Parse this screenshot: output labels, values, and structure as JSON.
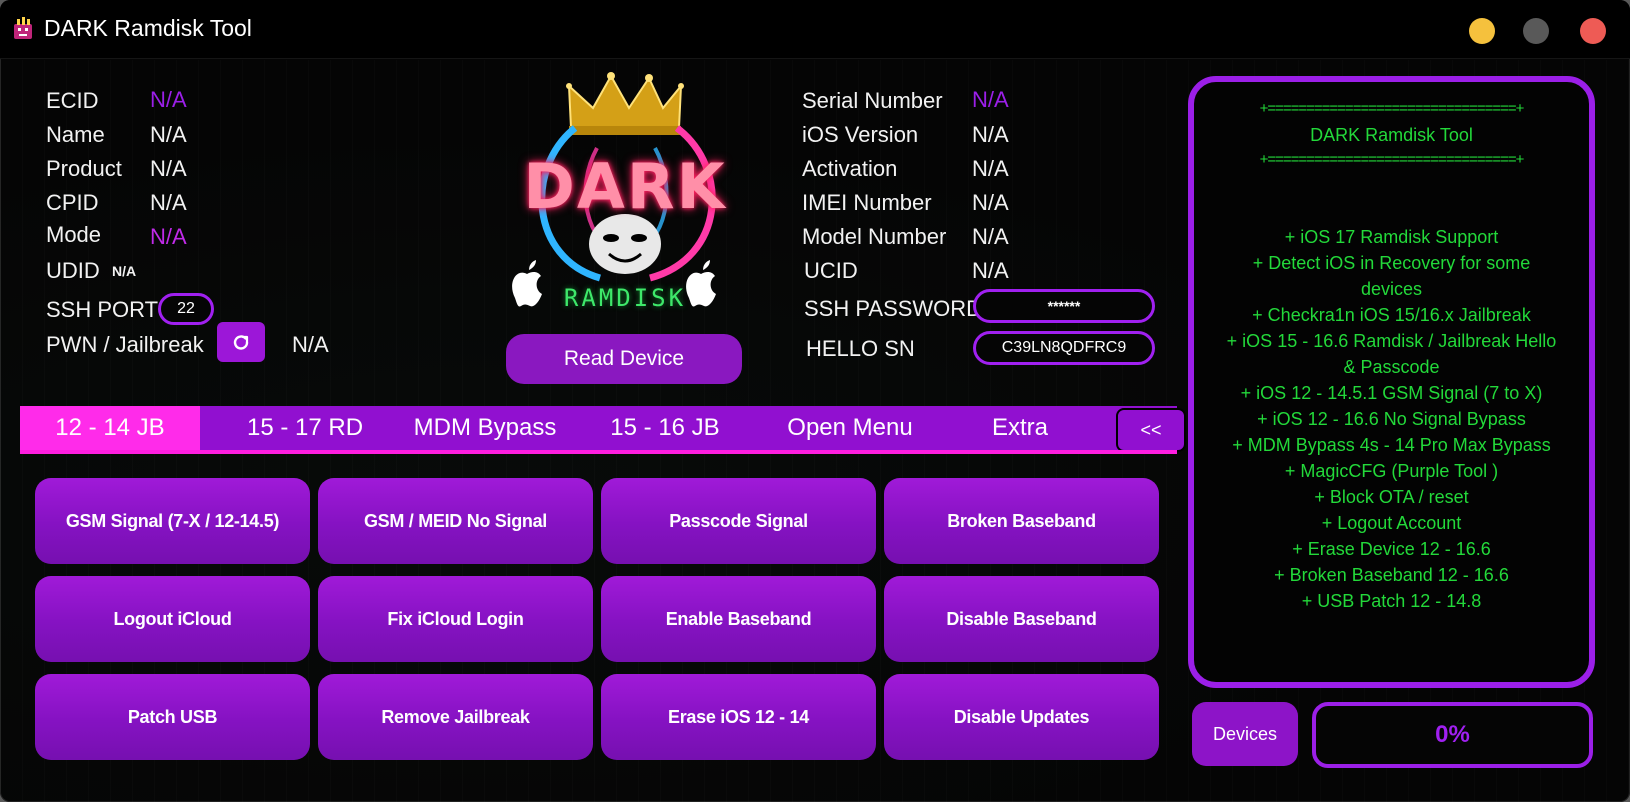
{
  "window": {
    "title": "DARK Ramdisk Tool",
    "controls": {
      "minimize_color": "#f5c13d",
      "maximize_color": "#595959",
      "close_color": "#ee5b55"
    }
  },
  "info_left": {
    "ecid": {
      "label": "ECID",
      "value": "N/A"
    },
    "name": {
      "label": "Name",
      "value": "N/A"
    },
    "product": {
      "label": "Product",
      "value": "N/A"
    },
    "cpid": {
      "label": "CPID",
      "value": "N/A"
    },
    "mode": {
      "label": "Mode",
      "value": "N/A"
    },
    "udid": {
      "label": "UDID",
      "value": "N/A"
    },
    "ssh_port": {
      "label": "SSH PORT",
      "value": "22"
    },
    "pwn": {
      "label": "PWN / Jailbreak",
      "value": "N/A"
    }
  },
  "logo": {
    "title": "DARK",
    "subtitle": "RAMDISK"
  },
  "read_device_label": "Read Device",
  "info_right": {
    "serial": {
      "label": "Serial Number",
      "value": "N/A"
    },
    "ios_version": {
      "label": "iOS Version",
      "value": "N/A"
    },
    "activation": {
      "label": "Activation",
      "value": "N/A"
    },
    "imei": {
      "label": "IMEI Number",
      "value": "N/A"
    },
    "model": {
      "label": "Model Number",
      "value": "N/A"
    },
    "ucid": {
      "label": "UCID",
      "value": "N/A"
    },
    "ssh_password": {
      "label": "SSH PASSWORD",
      "value": "******"
    },
    "hello_sn": {
      "label": "HELLO SN",
      "value": "C39LN8QDFRC9"
    }
  },
  "tabs": [
    {
      "label": "12 - 14 JB",
      "active": true
    },
    {
      "label": "15 - 17 RD"
    },
    {
      "label": "MDM Bypass"
    },
    {
      "label": "15 - 16 JB"
    },
    {
      "label": "Open Menu"
    },
    {
      "label": "Extra"
    }
  ],
  "tab_collapse_label": "<<",
  "actions": [
    "GSM Signal (7-X / 12-14.5)",
    "GSM / MEID No Signal",
    "Passcode Signal",
    "Broken Baseband",
    "Logout iCloud",
    "Fix iCloud Login",
    "Enable Baseband",
    "Disable Baseband",
    "Patch USB",
    "Remove Jailbreak",
    "Erase iOS 12 - 14",
    "Disable Updates"
  ],
  "log": {
    "separator": "+================================+",
    "title": "DARK Ramdisk Tool",
    "lines": [
      "+ iOS 17 Ramdisk Support",
      "+ Detect iOS in Recovery for some",
      "devices",
      "+ Checkra1n iOS 15/16.x Jailbreak",
      "+ iOS 15 - 16.6 Ramdisk / Jailbreak Hello",
      "& Passcode",
      "+ iOS 12 - 14.5.1 GSM Signal (7 to X)",
      "+ iOS 12 - 16.6 No Signal Bypass",
      "+ MDM Bypass 4s - 14 Pro Max Bypass",
      "+ MagicCFG (Purple Tool )",
      "+ Block OTA / reset",
      "+ Logout Account",
      "+ Erase Device 12 - 16.6",
      "+ Broken Baseband 12 - 16.6",
      "+ USB Patch 12 - 14.8"
    ]
  },
  "devices_label": "Devices",
  "progress": {
    "label": "0%",
    "value": 0
  }
}
